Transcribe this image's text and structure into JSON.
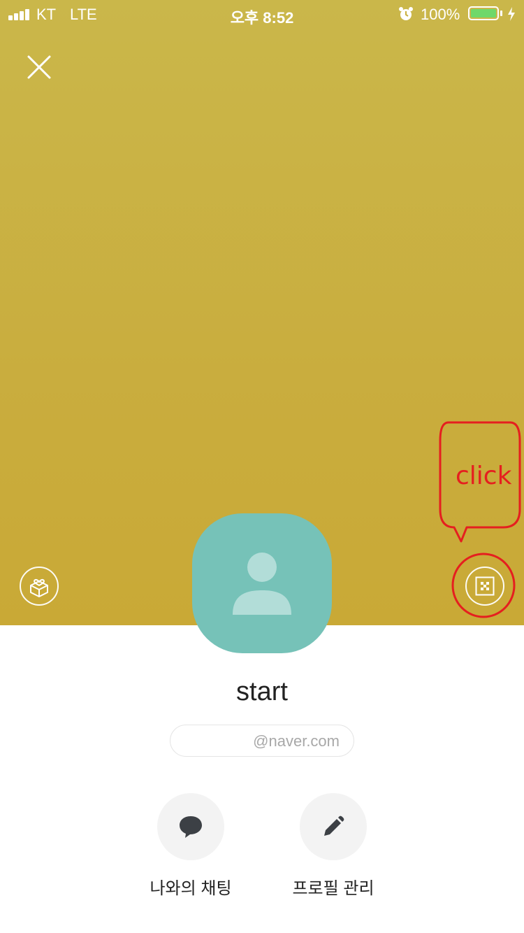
{
  "status_bar": {
    "carrier": "KT",
    "network": "LTE",
    "time": "오후 8:52",
    "battery": "100%",
    "battery_level": 1.0
  },
  "hero": {
    "background_color": "#c9b040",
    "close_icon": "close-icon",
    "gift_icon": "gift-box-icon",
    "qr_icon": "qr-code-icon"
  },
  "annotation": {
    "text": "click",
    "color": "#e51f1f"
  },
  "profile": {
    "avatar_color": "#76c2b8",
    "name": "start",
    "email": "@naver.com"
  },
  "actions": [
    {
      "label": "나와의 채팅",
      "icon": "chat-bubble-icon"
    },
    {
      "label": "프로필 관리",
      "icon": "pencil-icon"
    }
  ]
}
